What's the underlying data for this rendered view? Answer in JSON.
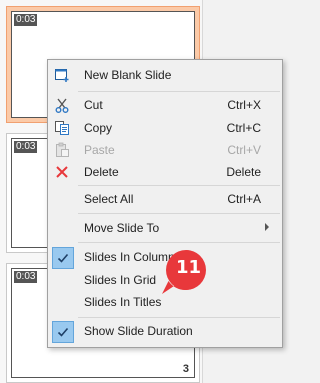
{
  "slides": [
    {
      "duration": "0:03",
      "number": ""
    },
    {
      "duration": "0:03",
      "number": ""
    },
    {
      "duration": "0:03",
      "number": "3"
    }
  ],
  "menu": {
    "new_blank_slide": "New Blank Slide",
    "cut": {
      "label": "Cut",
      "shortcut": "Ctrl+X"
    },
    "copy": {
      "label": "Copy",
      "shortcut": "Ctrl+C"
    },
    "paste": {
      "label": "Paste",
      "shortcut": "Ctrl+V"
    },
    "delete": {
      "label": "Delete",
      "shortcut": "Delete"
    },
    "select_all": {
      "label": "Select All",
      "shortcut": "Ctrl+A"
    },
    "move_slide_to": "Move Slide To",
    "slides_in_column": "Slides In Column",
    "slides_in_grid": "Slides In Grid",
    "slides_in_titles": "Slides In Titles",
    "show_slide_duration": "Show Slide Duration"
  },
  "badge": {
    "number": "11",
    "color": "#e8383b"
  },
  "colors": {
    "selected_slide": "#fbcaa8",
    "check_bg": "#99c9ef",
    "accent_red": "#e8383b"
  }
}
